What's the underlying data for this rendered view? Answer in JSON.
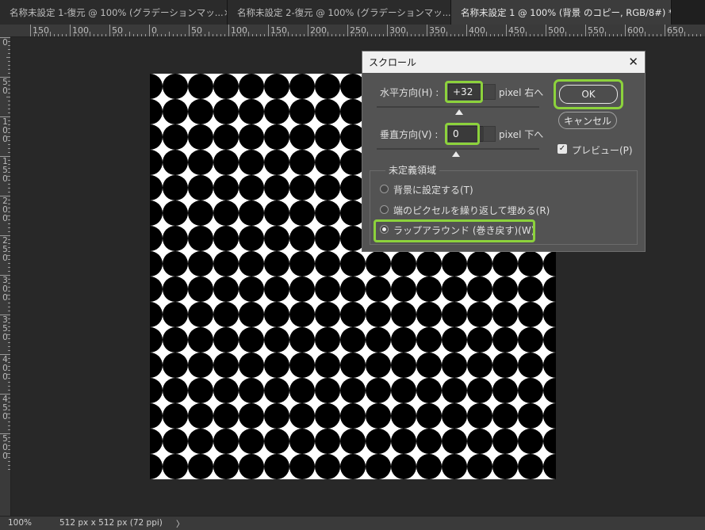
{
  "tabs": [
    {
      "label": "名称未設定 1-復元 @ 100% (グラデーションマッ...",
      "close": "×"
    },
    {
      "label": "名称未設定 2-復元 @ 100% (グラデーションマッ...",
      "close": "×"
    },
    {
      "label": "名称未設定 1 @ 100% (背景 のコピー, RGB/8#) *",
      "close": "×"
    }
  ],
  "ruler_top_labels": [
    "150",
    "100",
    "50",
    "0",
    "50",
    "100",
    "150",
    "200",
    "250",
    "300",
    "350",
    "400",
    "450",
    "500",
    "550",
    "600",
    "650"
  ],
  "ruler_left_labels": [
    "0",
    "5\n0",
    "1\n0\n0",
    "1\n5\n0",
    "2\n0\n0",
    "2\n5\n0",
    "3\n0\n0",
    "3\n5\n0",
    "4\n0\n0",
    "4\n5\n0",
    "5\n0\n0"
  ],
  "dialog": {
    "title": "スクロール",
    "close": "✕",
    "horizontal": {
      "label": "水平方向(H) :",
      "value": "+32",
      "unit": "pixel 右へ"
    },
    "vertical": {
      "label": "垂直方向(V) :",
      "value": "0",
      "unit": "pixel 下へ"
    },
    "ok_label": "OK",
    "cancel_label": "キャンセル",
    "preview": {
      "label": "プレビュー(P)",
      "checked": true
    },
    "group_title": "未定義領域",
    "radios": [
      {
        "label": "背景に設定する(T)",
        "selected": false
      },
      {
        "label": "端のピクセルを繰り返して埋める(R)",
        "selected": false
      },
      {
        "label": "ラップアラウンド (巻き戻す)(W)",
        "selected": true
      }
    ],
    "highlight_color": "#8cd23c"
  },
  "status": {
    "zoom": "100%",
    "doc_size": "512 px x 512 px (72 ppi)",
    "arrow": "〉"
  }
}
